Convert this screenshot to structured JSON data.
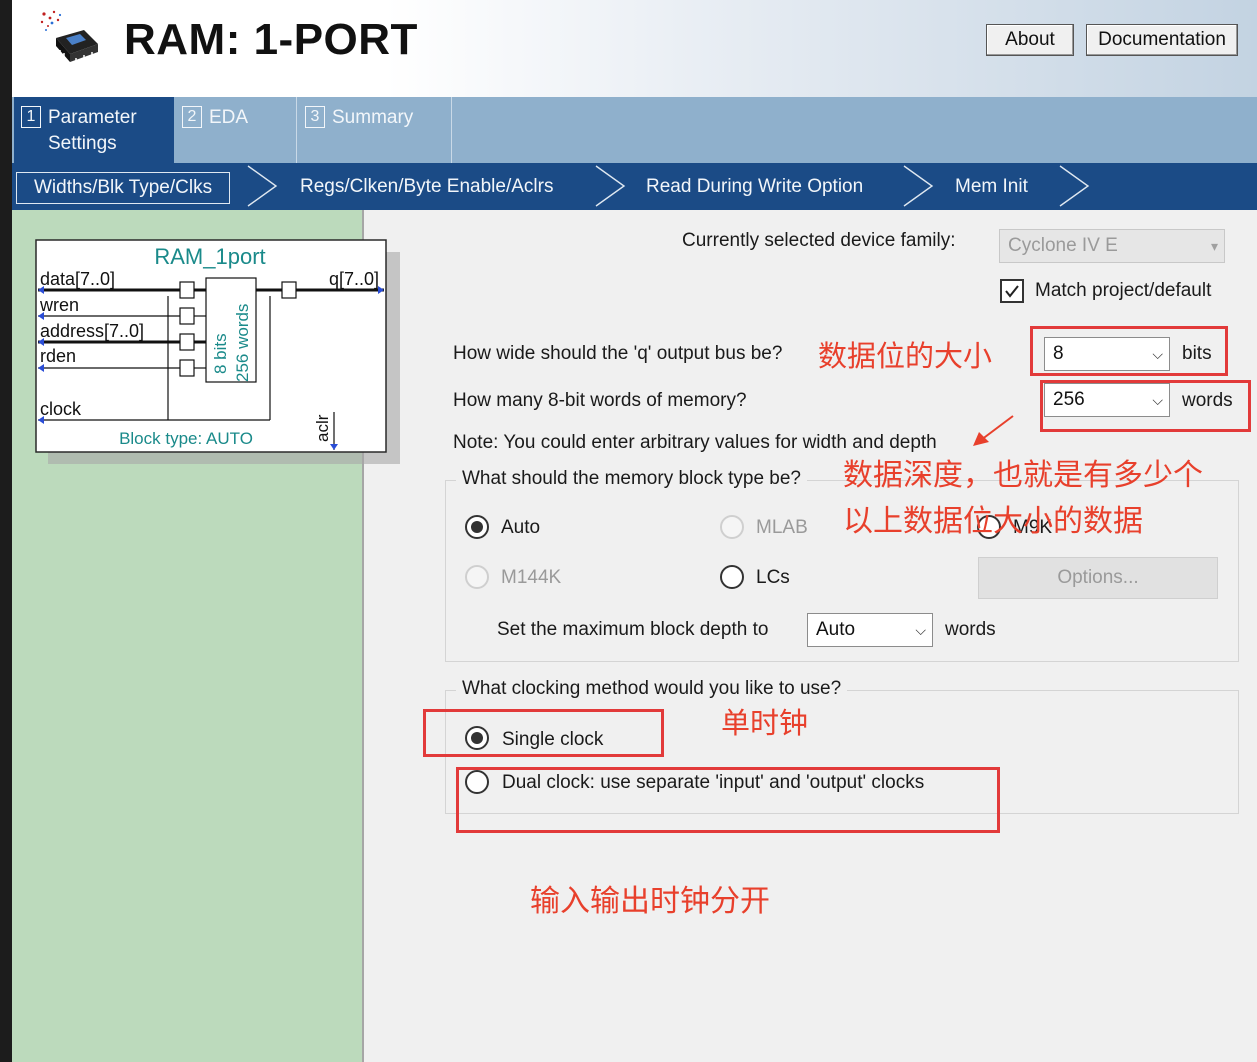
{
  "window": {
    "title": "RAM: 1-PORT",
    "about_label": "About",
    "documentation_label": "Documentation"
  },
  "tabs": [
    {
      "num": "1",
      "label_line1": "Parameter",
      "label_line2": "Settings"
    },
    {
      "num": "2",
      "label": "EDA"
    },
    {
      "num": "3",
      "label": "Summary"
    }
  ],
  "breadcrumbs": [
    "Widths/Blk Type/Clks",
    "Regs/Clken/Byte Enable/Aclrs",
    "Read During Write Option",
    "Mem Init"
  ],
  "symbol": {
    "name": "RAM_1port",
    "ports_left": [
      "data[7..0]",
      "wren",
      "address[7..0]",
      "rden",
      "clock"
    ],
    "port_right": "q[7..0]",
    "bits_label": "8 bits",
    "words_label": "256 words",
    "aclr_label": "aclr",
    "block_type": "Block type: AUTO"
  },
  "device": {
    "label": "Currently selected device family:",
    "value": "Cyclone IV E",
    "match_label": "Match project/default",
    "match_checked": true
  },
  "width": {
    "question": "How wide should the 'q' output bus be?",
    "value": "8",
    "unit": "bits"
  },
  "depth": {
    "question": "How many 8-bit words of memory?",
    "value": "256",
    "unit": "words"
  },
  "note": "Note: You could enter arbitrary values for width and depth",
  "block_type": {
    "question": "What should the memory block type be?",
    "options": [
      {
        "label": "Auto",
        "selected": true,
        "enabled": true
      },
      {
        "label": "MLAB",
        "selected": false,
        "enabled": false
      },
      {
        "label": "M9K",
        "selected": false,
        "enabled": true
      },
      {
        "label": "M144K",
        "selected": false,
        "enabled": false
      },
      {
        "label": "LCs",
        "selected": false,
        "enabled": true
      }
    ],
    "options_button": "Options...",
    "max_depth_label": "Set the maximum block depth to",
    "max_depth_value": "Auto",
    "max_depth_unit": "words"
  },
  "clocking": {
    "question": "What clocking method would you like to use?",
    "options": [
      {
        "label": "Single clock",
        "selected": true
      },
      {
        "label": "Dual clock: use separate 'input' and 'output' clocks",
        "selected": false
      }
    ]
  },
  "annotations": {
    "width_note": "数据位的大小",
    "depth_note_line1": "数据深度，也就是有多少个",
    "depth_note_line2": "以上数据位大小的数据",
    "single_clock_note": "单时钟",
    "dual_clock_note": "输入输出时钟分开",
    "color": "#e8402c"
  },
  "colors": {
    "tab_active": "#1b4b86",
    "tab_bar": "#8fb0cc",
    "left_pane": "#bcdabc",
    "symbol_text": "#1a8a8a"
  }
}
